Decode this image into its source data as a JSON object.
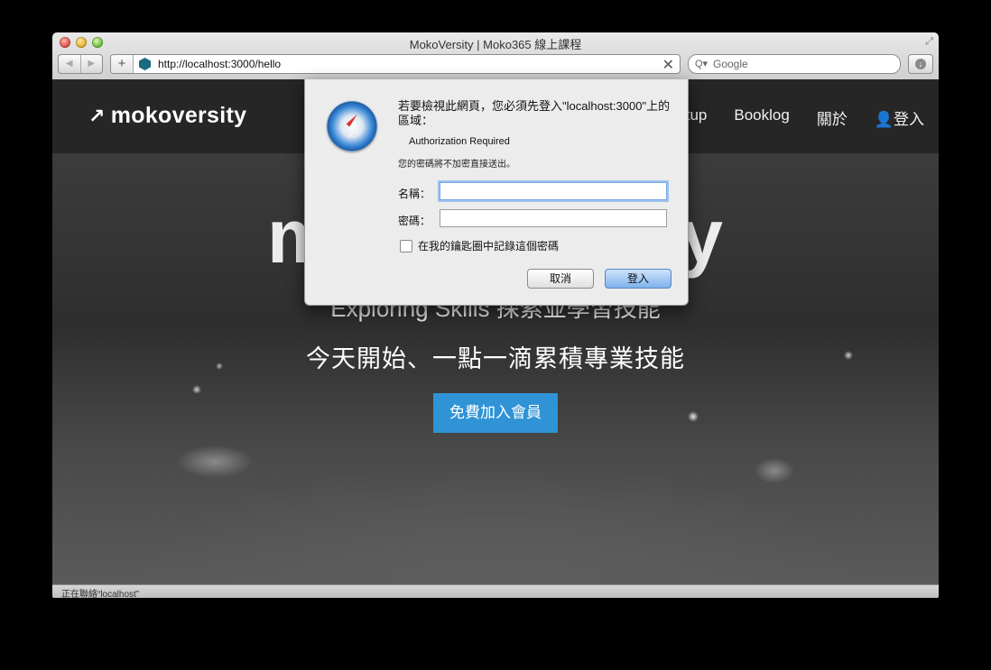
{
  "window": {
    "title": "MokoVersity | Moko365 線上課程"
  },
  "toolbar": {
    "back_icon": "◀",
    "forward_icon": "▶",
    "add_icon": "+",
    "url": "http://localhost:3000/hello",
    "clear_icon": "✕",
    "search_placeholder": "Google",
    "search_icon_glyph": "Q▾",
    "download_icon": "↓"
  },
  "site": {
    "logo": "mokoversity",
    "logo_icon": "↗",
    "nav": [
      "Startup",
      "Booklog",
      "關於",
      "登入"
    ],
    "nav_user_icon": "👤",
    "hero_title": "mokoversity",
    "hero_subtitle": "Exploring Skills 探索並學習技能",
    "hero_tagline": "今天開始、一點一滴累積專業技能",
    "join_button": "免費加入會員"
  },
  "auth_dialog": {
    "message": "若要檢視此網頁，您必須先登入\"localhost:3000\"上的區域：",
    "realm": "Authorization Required",
    "warning": "您的密碼將不加密直接送出。",
    "name_label": "名稱：",
    "name_value": "",
    "password_label": "密碼：",
    "password_value": "",
    "remember_label": "在我的鑰匙圈中記錄這個密碼",
    "remember_checked": false,
    "cancel_button": "取消",
    "login_button": "登入"
  },
  "status_bar": {
    "text": "正在聯絡“localhost”"
  },
  "colors": {
    "join_button": "#2f93d6",
    "nav_background": "#262626"
  }
}
